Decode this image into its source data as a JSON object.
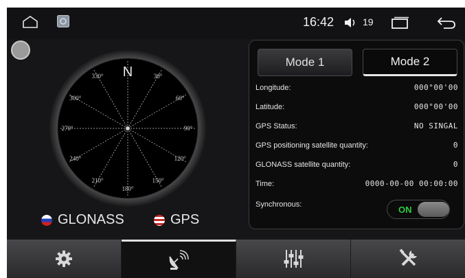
{
  "status_bar": {
    "time": "16:42",
    "volume": "19",
    "icons": [
      "home-icon",
      "app-thumbnail-icon",
      "volume-icon",
      "recent-apps-icon",
      "back-icon"
    ]
  },
  "compass": {
    "north": "N",
    "degrees": [
      "30°",
      "60°",
      "90°",
      "120°",
      "150°",
      "180°",
      "210°",
      "240°",
      "270°",
      "300°",
      "330°"
    ]
  },
  "legend": {
    "glonass": "GLONASS",
    "gps": "GPS"
  },
  "modes": {
    "mode1": "Mode 1",
    "mode2": "Mode 2",
    "selected": "Mode 2"
  },
  "info": {
    "longitude_label": "Longitude:",
    "longitude_value": "000°00'00",
    "latitude_label": "Latitude:",
    "latitude_value": "000°00'00",
    "gps_status_label": "GPS Status:",
    "gps_status_value": "NO SINGAL",
    "gps_sat_label": "GPS positioning satellite quantity:",
    "gps_sat_value": "0",
    "glonass_sat_label": "GLONASS satellite quantity:",
    "glonass_sat_value": "0",
    "time_label": "Time:",
    "time_value": "0000-00-00 00:00:00",
    "sync_label": "Synchronous:",
    "sync_value": "ON"
  },
  "colors": {
    "glonass_flag": "#d42020",
    "gps_flag": "#c62828",
    "toggle_on": "#2ecc40",
    "background": "#161618"
  },
  "bottom_tabs": [
    "settings-gear-icon",
    "satellite-dish-icon",
    "equalizer-sliders-icon",
    "tools-icon"
  ],
  "active_tab": 1
}
